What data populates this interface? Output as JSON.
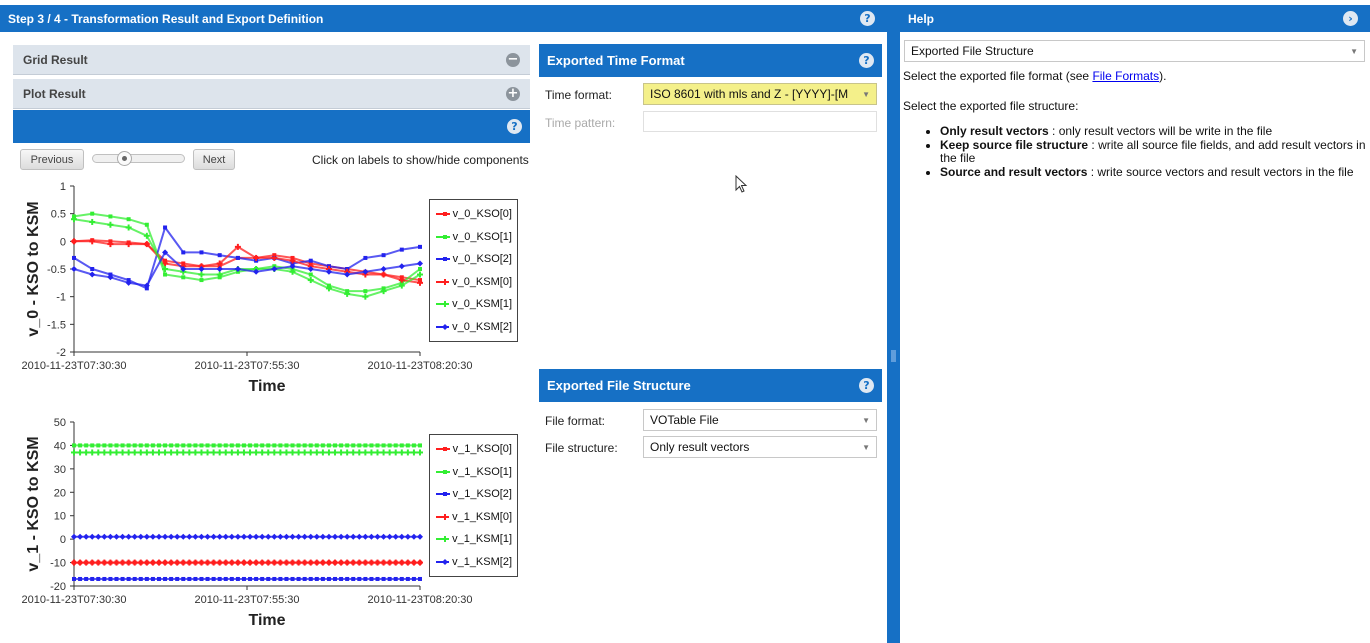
{
  "main_panel": {
    "title": "Step 3 / 4 - Transformation Result and Export Definition",
    "help_icon": "?"
  },
  "help_panel": {
    "title": "Help",
    "topic_select": "Exported File Structure",
    "line1_prefix": "Select the exported file format (see ",
    "line1_link": "File Formats",
    "line1_suffix": ").",
    "line2": "Select the exported file structure:",
    "bullets": [
      {
        "bold": "Only result vectors",
        "text": " : only result vectors will be write in the file"
      },
      {
        "bold": "Keep source file structure",
        "text": " : write all source file fields, and add result vectors in the file"
      },
      {
        "bold": "Source and result vectors",
        "text": " : write source vectors and result vectors in the file"
      }
    ]
  },
  "accordion": {
    "grid_result": "Grid Result",
    "plot_result": "Plot Result",
    "minus": "−",
    "plus": "+"
  },
  "plot_nav": {
    "previous": "Previous",
    "next": "Next",
    "hint": "Click on labels to show/hide components"
  },
  "time_format": {
    "title": "Exported Time Format",
    "time_format_label": "Time format:",
    "time_format_value": "ISO 8601 with mls and Z - [YYYY]-[M",
    "time_pattern_label": "Time pattern:",
    "time_pattern_value": ""
  },
  "file_structure": {
    "title": "Exported File Structure",
    "file_format_label": "File format:",
    "file_format_value": "VOTable File",
    "file_structure_label": "File structure:",
    "file_structure_value": "Only result vectors"
  },
  "colors": {
    "header": "#1670c5",
    "red": "#ff1e1e",
    "green": "#33ee33",
    "blue": "#2222ee"
  },
  "chart_data": [
    {
      "type": "line",
      "xlabel": "Time",
      "ylabel": "v_0 - KSO to KSM",
      "ylim": [
        -2,
        1
      ],
      "yticks": [
        1,
        0.5,
        0,
        -0.5,
        -1,
        -1.5,
        -2
      ],
      "xticks": [
        "2010-11-23T07:30:30",
        "2010-11-23T07:55:30",
        "2010-11-23T08:20:30"
      ],
      "legend": "right",
      "series": [
        {
          "name": "v_0_KSO[0]",
          "color": "#ff1e1e",
          "marker": "square",
          "values": [
            0.0,
            0.02,
            0.0,
            -0.02,
            -0.05,
            -0.35,
            -0.4,
            -0.45,
            -0.45,
            -0.3,
            -0.3,
            -0.25,
            -0.3,
            -0.4,
            -0.45,
            -0.5,
            -0.55,
            -0.6,
            -0.65,
            -0.7
          ]
        },
        {
          "name": "v_0_KSO[1]",
          "color": "#33ee33",
          "marker": "square",
          "values": [
            0.45,
            0.5,
            0.45,
            0.4,
            0.3,
            -0.6,
            -0.65,
            -0.7,
            -0.65,
            -0.55,
            -0.5,
            -0.45,
            -0.5,
            -0.6,
            -0.8,
            -0.9,
            -0.9,
            -0.85,
            -0.75,
            -0.5
          ]
        },
        {
          "name": "v_0_KSO[2]",
          "color": "#2222ee",
          "marker": "square",
          "values": [
            -0.3,
            -0.5,
            -0.6,
            -0.7,
            -0.85,
            0.25,
            -0.2,
            -0.2,
            -0.25,
            -0.3,
            -0.35,
            -0.3,
            -0.4,
            -0.35,
            -0.45,
            -0.5,
            -0.3,
            -0.25,
            -0.15,
            -0.1
          ]
        },
        {
          "name": "v_0_KSM[0]",
          "color": "#ff1e1e",
          "marker": "plus",
          "values": [
            0.0,
            0.0,
            -0.05,
            -0.05,
            -0.05,
            -0.4,
            -0.45,
            -0.45,
            -0.4,
            -0.1,
            -0.3,
            -0.3,
            -0.35,
            -0.45,
            -0.5,
            -0.55,
            -0.6,
            -0.6,
            -0.7,
            -0.75
          ]
        },
        {
          "name": "v_0_KSM[1]",
          "color": "#33ee33",
          "marker": "plus",
          "values": [
            0.4,
            0.35,
            0.3,
            0.25,
            0.1,
            -0.5,
            -0.55,
            -0.6,
            -0.6,
            -0.5,
            -0.5,
            -0.5,
            -0.55,
            -0.7,
            -0.85,
            -0.95,
            -1.0,
            -0.9,
            -0.8,
            -0.6
          ]
        },
        {
          "name": "v_0_KSM[2]",
          "color": "#2222ee",
          "marker": "diamond",
          "values": [
            -0.5,
            -0.6,
            -0.65,
            -0.75,
            -0.8,
            -0.2,
            -0.5,
            -0.5,
            -0.5,
            -0.5,
            -0.55,
            -0.5,
            -0.45,
            -0.5,
            -0.55,
            -0.6,
            -0.55,
            -0.5,
            -0.45,
            -0.4
          ]
        }
      ]
    },
    {
      "type": "line",
      "xlabel": "Time",
      "ylabel": "v_1 - KSO to KSM",
      "ylim": [
        -20,
        50
      ],
      "yticks": [
        50,
        40,
        30,
        20,
        10,
        0,
        -10,
        -20
      ],
      "xticks": [
        "2010-11-23T07:30:30",
        "2010-11-23T07:55:30",
        "2010-11-23T08:20:30"
      ],
      "legend": "right",
      "series": [
        {
          "name": "v_1_KSO[0]",
          "color": "#ff1e1e",
          "marker": "square",
          "value": -10
        },
        {
          "name": "v_1_KSO[1]",
          "color": "#33ee33",
          "marker": "square",
          "value": 40
        },
        {
          "name": "v_1_KSO[2]",
          "color": "#2222ee",
          "marker": "square",
          "value": -17
        },
        {
          "name": "v_1_KSM[0]",
          "color": "#ff1e1e",
          "marker": "plus",
          "value": -10
        },
        {
          "name": "v_1_KSM[1]",
          "color": "#33ee33",
          "marker": "plus",
          "value": 37
        },
        {
          "name": "v_1_KSM[2]",
          "color": "#2222ee",
          "marker": "diamond",
          "value": 1
        }
      ]
    }
  ]
}
